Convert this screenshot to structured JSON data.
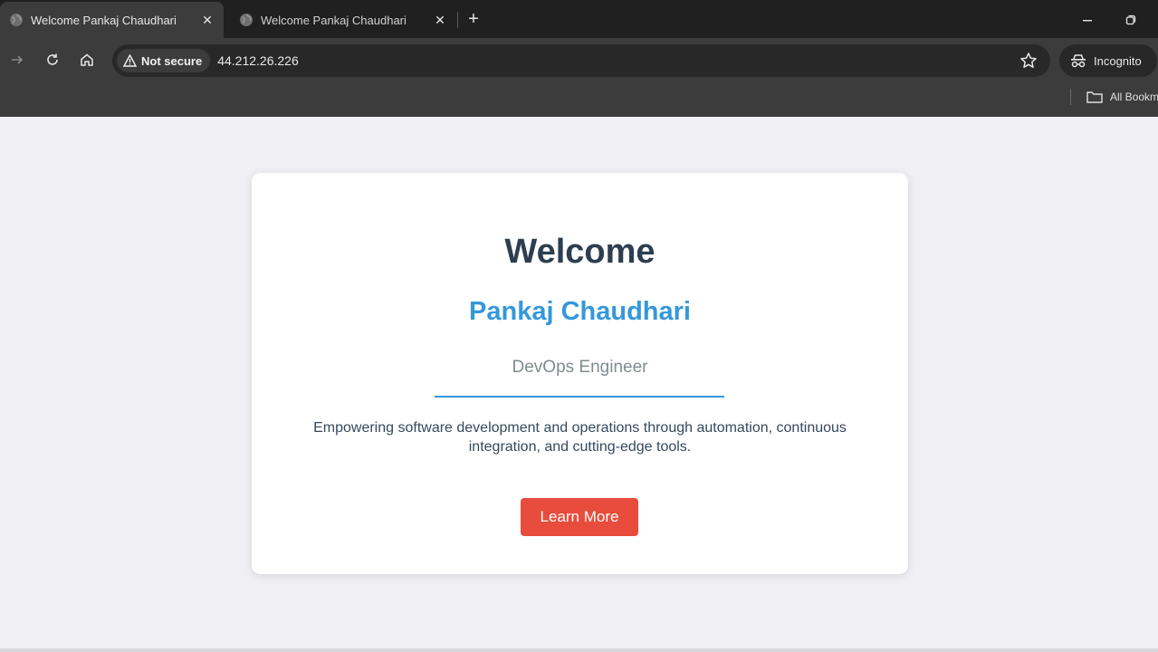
{
  "browser": {
    "tabs": [
      {
        "title": "Welcome Pankaj Chaudhari",
        "active": true
      },
      {
        "title": "Welcome Pankaj Chaudhari",
        "active": false
      }
    ],
    "security_label": "Not secure",
    "url": "44.212.26.226",
    "profile_label": "Incognito",
    "bookmarks_label": "All Bookmarks",
    "icons": [
      "globe-icon",
      "close-icon",
      "plus-icon",
      "minimize-icon",
      "restore-icon",
      "forward-icon",
      "reload-icon",
      "home-icon",
      "warning-icon",
      "star-icon",
      "incognito-icon",
      "folder-icon"
    ]
  },
  "page": {
    "heading": "Welcome",
    "name": "Pankaj Chaudhari",
    "role": "DevOps Engineer",
    "description": "Empowering software development and operations through automation, continuous integration, and cutting-edge tools.",
    "cta_label": "Learn More"
  },
  "colors": {
    "heading": "#2c3e50",
    "accent": "#3498db",
    "role": "#7f8c8d",
    "button": "#e74c3c",
    "page_bg": "#f0eff4"
  }
}
